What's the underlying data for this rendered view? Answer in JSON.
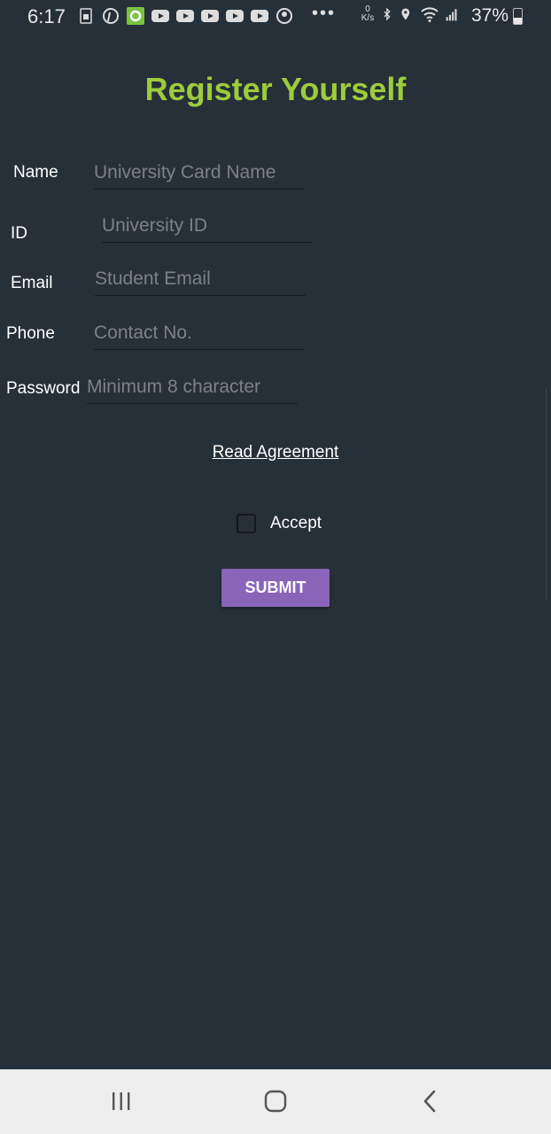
{
  "status_bar": {
    "time": "6:17",
    "battery_percent": "37%",
    "net_speed_value": "0",
    "net_speed_unit": "K/s",
    "icons": [
      "sim-icon",
      "pinterest-icon",
      "app-icon",
      "youtube-icon",
      "youtube-icon",
      "youtube-icon",
      "youtube-icon",
      "youtube-icon",
      "account-icon",
      "more-icon",
      "bluetooth-icon",
      "location-icon",
      "wifi-icon",
      "signal-icon",
      "battery-icon"
    ]
  },
  "page": {
    "title": "Register Yourself",
    "title_color": "#9ccc3c",
    "background_color": "#263038"
  },
  "form": {
    "name": {
      "label": "Name",
      "placeholder": "University Card Name"
    },
    "id": {
      "label": "ID",
      "placeholder": "University ID"
    },
    "email": {
      "label": "Email",
      "placeholder": "Student Email"
    },
    "phone": {
      "label": "Phone",
      "placeholder": "Contact No."
    },
    "password": {
      "label": "Password",
      "placeholder": "Minimum 8 character"
    },
    "agreement_link": "Read Agreement",
    "accept_label": "Accept",
    "accept_checked": false,
    "submit_label": "SUBMIT",
    "submit_color": "#8a64b8"
  },
  "nav_bar": {
    "recents_icon": "recents-icon",
    "home_icon": "home-icon",
    "back_icon": "back-icon"
  }
}
